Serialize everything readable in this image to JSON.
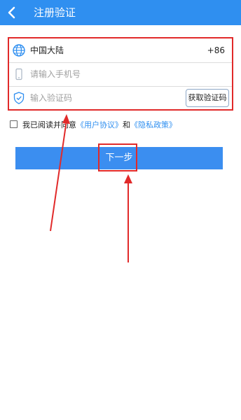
{
  "header": {
    "title": "注册验证"
  },
  "form": {
    "country": {
      "label": "中国大陆",
      "code": "+86"
    },
    "phone": {
      "placeholder": "请输入手机号"
    },
    "verify": {
      "placeholder": "输入验证码",
      "get_code_label": "获取验证码"
    }
  },
  "agreement": {
    "prefix": "我已阅读并同意",
    "user_agreement": "《用户协议》",
    "and": "和",
    "privacy_policy": "《隐私政策》"
  },
  "next_button": {
    "label": "下一步"
  },
  "colors": {
    "header_bg": "#2f8ff0",
    "button_bg": "#3b8ef0",
    "annotation": "#e12a2a",
    "link": "#2f8ff0"
  },
  "icons": [
    "back-arrow-icon",
    "globe-icon",
    "phone-icon",
    "shield-check-icon"
  ]
}
